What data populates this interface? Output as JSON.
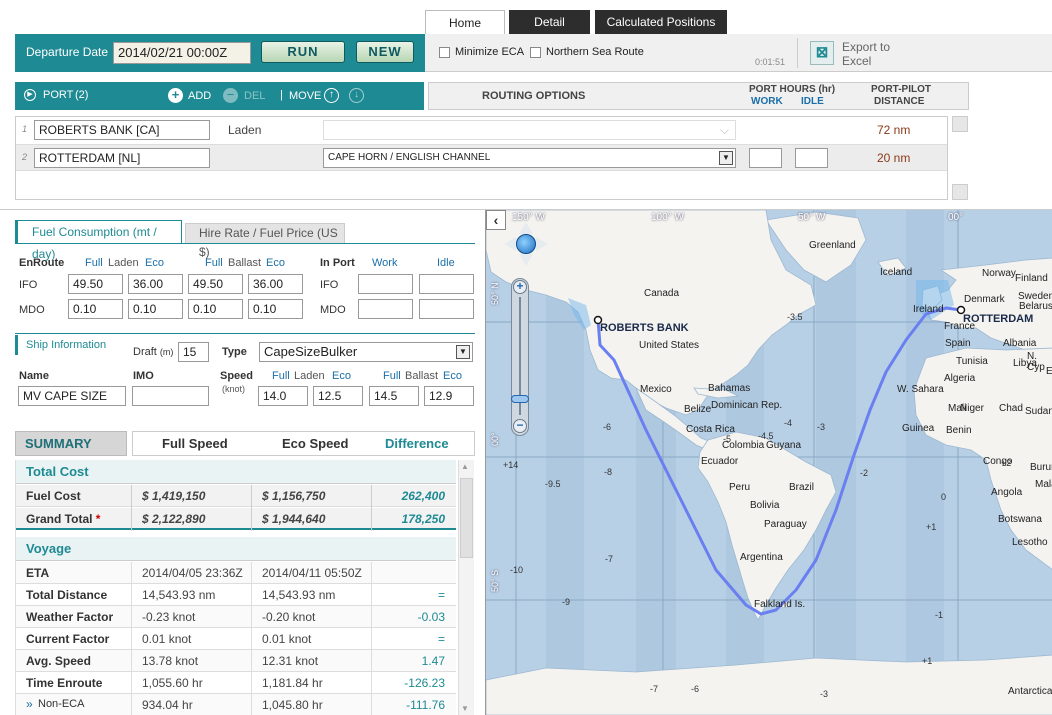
{
  "tabs": {
    "home": "Home",
    "detail": "Detail",
    "calc": "Calculated Positions"
  },
  "top": {
    "departure_label": "Departure Date",
    "departure_value": "2014/02/21 00:00Z",
    "run": "RUN",
    "new": "NEW",
    "minimize_eca": "Minimize ECA",
    "northern_sea_route": "Northern Sea Route",
    "timer": "0:01:51",
    "export_line1": "Export to",
    "export_line2": "Excel"
  },
  "portbar": {
    "port": "PORT",
    "count": "(2)",
    "add": "ADD",
    "del": "DEL",
    "move": "MOVE",
    "routing_options": "ROUTING OPTIONS",
    "port_hours": "PORT HOURS (hr)",
    "work": "WORK",
    "idle": "IDLE",
    "port_pilot": "PORT-PILOT",
    "distance": "DISTANCE"
  },
  "ports": [
    {
      "num": "1",
      "name": "ROBERTS BANK [CA]",
      "cond": "Laden",
      "route": "",
      "dist": "72 nm"
    },
    {
      "num": "2",
      "name": "ROTTERDAM [NL]",
      "cond": "",
      "route": "CAPE HORN / ENGLISH CHANNEL",
      "dist": "20 nm"
    }
  ],
  "fuel": {
    "tab1": "Fuel Consumption (mt / day)",
    "tab2": "Hire Rate / Fuel Price (US $)",
    "enroute": "EnRoute",
    "full": "Full",
    "laden": "Laden",
    "eco": "Eco",
    "ballast": "Ballast",
    "inport": "In Port",
    "work": "Work",
    "idle": "Idle",
    "ifo": "IFO",
    "mdo": "MDO",
    "ifo_vals": [
      "49.50",
      "36.00",
      "49.50",
      "36.00"
    ],
    "mdo_vals": [
      "0.10",
      "0.10",
      "0.10",
      "0.10"
    ]
  },
  "ship": {
    "title": "Ship Information",
    "draft_label": "Draft",
    "draft_unit": "(m)",
    "draft": "15",
    "type_label": "Type",
    "type": "CapeSizeBulker",
    "name_label": "Name",
    "imo_label": "IMO",
    "speed_label": "Speed",
    "knot": "(knot)",
    "name": "MV CAPE SIZE",
    "imo": "",
    "speeds": [
      "14.0",
      "12.5",
      "14.5",
      "12.9"
    ]
  },
  "summary": {
    "title": "SUMMARY",
    "col_full": "Full Speed",
    "col_eco": "Eco Speed",
    "col_diff": "Difference",
    "total_cost": "Total Cost",
    "voyage": "Voyage",
    "cost_rows": [
      {
        "label": "Fuel Cost",
        "full": "$ 1,419,150",
        "eco": "$ 1,156,750",
        "diff": "262,400"
      },
      {
        "label": "Grand Total",
        "full": "$ 2,122,890",
        "eco": "$ 1,944,640",
        "diff": "178,250"
      }
    ],
    "voyage_rows": [
      {
        "label": "ETA",
        "full": "2014/04/05 23:36Z",
        "eco": "2014/04/11 05:50Z",
        "diff": ""
      },
      {
        "label": "Total Distance",
        "full": "14,543.93 nm",
        "eco": "14,543.93 nm",
        "diff": "="
      },
      {
        "label": "Weather Factor",
        "full": "-0.23 knot",
        "eco": "-0.20 knot",
        "diff": "-0.03"
      },
      {
        "label": "Current Factor",
        "full": "0.01 knot",
        "eco": "0.01 knot",
        "diff": "="
      },
      {
        "label": "Avg. Speed",
        "full": "13.78 knot",
        "eco": "12.31 knot",
        "diff": "1.47"
      },
      {
        "label": "Time Enroute",
        "full": "1,055.60 hr",
        "eco": "1,181.84 hr",
        "diff": "-126.23"
      },
      {
        "label": "Non-ECA",
        "full": "934.04 hr",
        "eco": "1,045.80 hr",
        "diff": "-111.76"
      }
    ]
  },
  "map": {
    "lon_labels": [
      "150° W",
      "100° W",
      "50° W",
      "00°"
    ],
    "lat_labels": [
      "50° N",
      "00°",
      "50° S"
    ],
    "places": [
      "Greenland",
      "Iceland",
      "Norway",
      "Finland",
      "Sweden",
      "Denmark",
      "Belarus",
      "Ireland",
      "France",
      "Spain",
      "Albania",
      "Tunisia",
      "Libya",
      "Egypt",
      "Algeria",
      "Canada",
      "United States",
      "Mexico",
      "Bahamas",
      "Dominican Rep.",
      "Belize",
      "Costa Rica",
      "Colombia",
      "Guyana",
      "Ecuador",
      "Peru",
      "Brazil",
      "Bolivia",
      "Paraguay",
      "Argentina",
      "Falkland Is.",
      "W. Sahara",
      "Mali",
      "Niger",
      "Chad",
      "Sudan",
      "Guinea",
      "Benin",
      "Congo",
      "Burundi",
      "Angola",
      "Malawi",
      "Botswana",
      "Lesotho",
      "Antarctica",
      "N. Cyp"
    ],
    "origin": "ROBERTS BANK",
    "dest": "ROTTERDAM",
    "tz_labels": [
      "-3.5",
      "-4",
      "-5",
      "-4.5",
      "-3",
      "-6",
      "-8",
      "-9.5",
      "+14",
      "-7",
      "-2",
      "-10",
      "-9",
      "-7",
      "-6",
      "-3",
      "+1",
      "0",
      "-1",
      "+1",
      "+2"
    ]
  },
  "colors": {
    "teal": "#1e8a93",
    "route": "#6a7ff0",
    "sea": "#b8d0e6",
    "land": "#f4f3ef"
  }
}
